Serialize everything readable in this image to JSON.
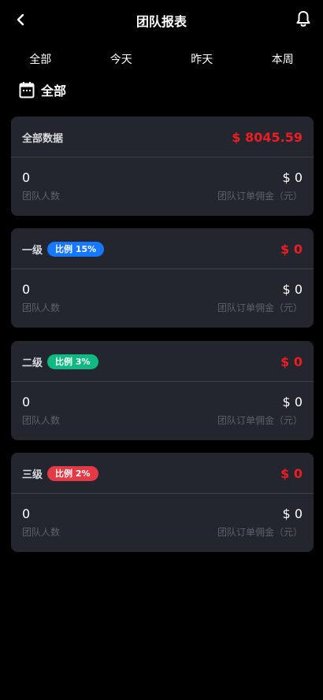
{
  "header": {
    "title": "团队报表",
    "back_icon": "chevron-left-icon",
    "bell_icon": "bell-icon"
  },
  "tabs": [
    {
      "label": "全部"
    },
    {
      "label": "今天"
    },
    {
      "label": "昨天"
    },
    {
      "label": "本周"
    }
  ],
  "date_filter": {
    "icon": "calendar-icon",
    "label": "全部"
  },
  "colors": {
    "amount_red": "#ee1d23",
    "card_bg": "#23262e",
    "badge_blue": "#1677ff",
    "badge_green": "#10b981",
    "badge_red": "#e63946"
  },
  "cards": [
    {
      "title": "全部数据",
      "badge": "",
      "amount": "$ 8045.59",
      "team_count": "0",
      "team_count_label": "团队人数",
      "commission": "$ 0",
      "commission_label": "团队订单佣金（元）"
    },
    {
      "title": "一级",
      "badge": "比例 15%",
      "badge_color": "#1677ff",
      "amount": "$ 0",
      "team_count": "0",
      "team_count_label": "团队人数",
      "commission": "$ 0",
      "commission_label": "团队订单佣金（元）"
    },
    {
      "title": "二级",
      "badge": "比例 3%",
      "badge_color": "#10b981",
      "amount": "$ 0",
      "team_count": "0",
      "team_count_label": "团队人数",
      "commission": "$ 0",
      "commission_label": "团队订单佣金（元）"
    },
    {
      "title": "三级",
      "badge": "比例 2%",
      "badge_color": "#e63946",
      "amount": "$ 0",
      "team_count": "0",
      "team_count_label": "团队人数",
      "commission": "$ 0",
      "commission_label": "团队订单佣金（元）"
    }
  ]
}
